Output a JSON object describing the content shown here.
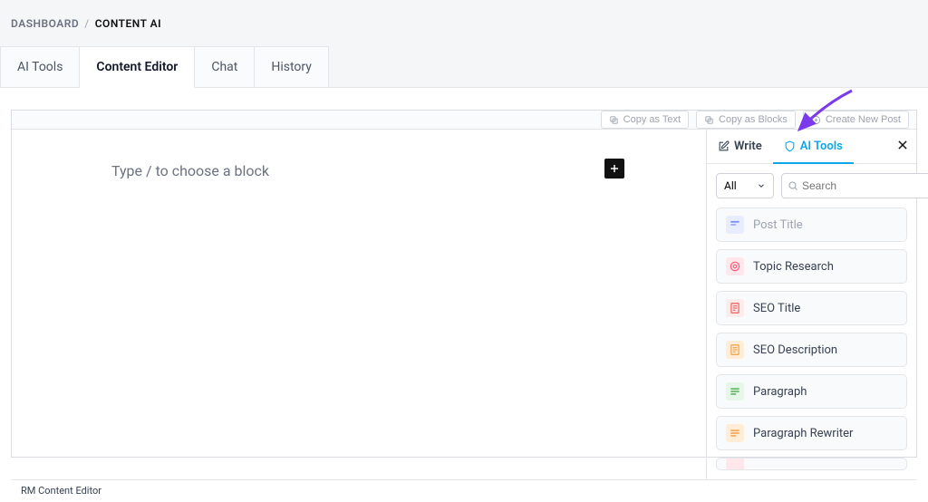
{
  "breadcrumb": {
    "root": "DASHBOARD",
    "current": "CONTENT AI"
  },
  "tabs": [
    {
      "label": "AI Tools",
      "active": false
    },
    {
      "label": "Content Editor",
      "active": true
    },
    {
      "label": "Chat",
      "active": false
    },
    {
      "label": "History",
      "active": false
    }
  ],
  "toolbar": {
    "copy_text": "Copy as Text",
    "copy_blocks": "Copy as Blocks",
    "create_post": "Create New Post"
  },
  "editor": {
    "placeholder": "Type / to choose a block"
  },
  "side_tabs": {
    "write": "Write",
    "ai_tools": "AI Tools"
  },
  "filter": {
    "value": "All"
  },
  "search": {
    "placeholder": "Search"
  },
  "tools": [
    {
      "label": "Post Title",
      "icon_bg": "#e7ecff",
      "icon_fg": "#7a8cff",
      "disabled": true,
      "glyph": "title"
    },
    {
      "label": "Topic Research",
      "icon_bg": "#ffe7eb",
      "icon_fg": "#ff5a7a",
      "disabled": false,
      "glyph": "target"
    },
    {
      "label": "SEO Title",
      "icon_bg": "#fdecec",
      "icon_fg": "#f05a5a",
      "disabled": false,
      "glyph": "doc"
    },
    {
      "label": "SEO Description",
      "icon_bg": "#ffedd8",
      "icon_fg": "#f59e42",
      "disabled": false,
      "glyph": "doc"
    },
    {
      "label": "Paragraph",
      "icon_bg": "#e6f6e8",
      "icon_fg": "#4caf50",
      "disabled": false,
      "glyph": "lines"
    },
    {
      "label": "Paragraph Rewriter",
      "icon_bg": "#ffedd8",
      "icon_fg": "#f59e42",
      "disabled": false,
      "glyph": "lines"
    }
  ],
  "footer": "RM Content Editor",
  "annotation": {
    "arrow_target": "ai-tools-tab"
  }
}
